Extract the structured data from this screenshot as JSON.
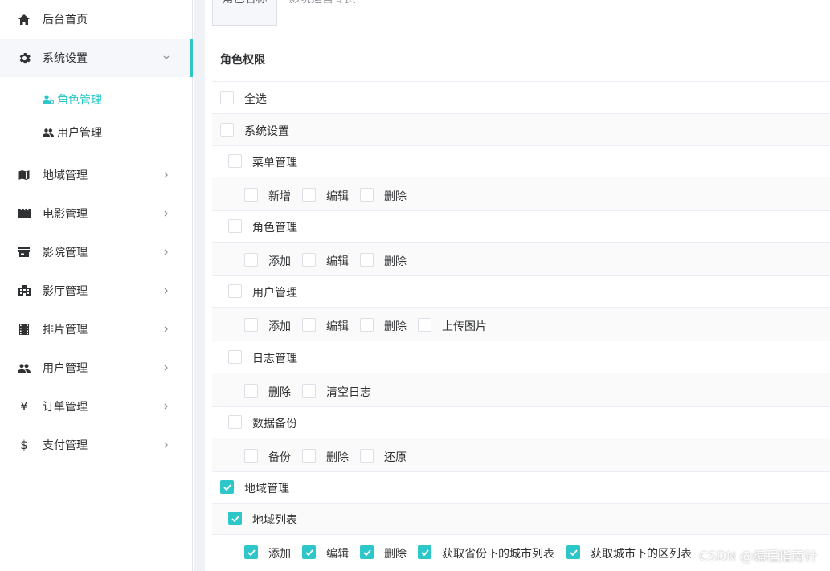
{
  "sidebar": {
    "home": "后台首页",
    "system_settings": "系统设置",
    "role_manage": "角色管理",
    "user_manage_sub": "用户管理",
    "region": "地域管理",
    "movie": "电影管理",
    "cinema": "影院管理",
    "hall": "影厅管理",
    "schedule": "排片管理",
    "users": "用户管理",
    "orders": "订单管理",
    "payment": "支付管理",
    "accent_color": "#2ec7c9"
  },
  "form": {
    "role_name_label": "角色名称",
    "role_name_value": "影院运营专员",
    "permissions_title": "角色权限"
  },
  "perms": {
    "select_all": "全选",
    "system": "系统设置",
    "menu": "菜单管理",
    "menu_add": "新增",
    "menu_edit": "编辑",
    "menu_delete": "删除",
    "role": "角色管理",
    "role_add": "添加",
    "role_edit": "编辑",
    "role_delete": "删除",
    "user": "用户管理",
    "user_add": "添加",
    "user_edit": "编辑",
    "user_delete": "删除",
    "user_upload": "上传图片",
    "log": "日志管理",
    "log_delete": "删除",
    "log_clear": "清空日志",
    "backup": "数据备份",
    "backup_backup": "备份",
    "backup_delete": "删除",
    "backup_restore": "还原",
    "region": "地域管理",
    "region_list": "地域列表",
    "rl_add": "添加",
    "rl_edit": "编辑",
    "rl_delete": "删除",
    "rl_cities": "获取省份下的城市列表",
    "rl_districts": "获取城市下的区列表"
  },
  "watermark": "CSDN @编程指南针"
}
